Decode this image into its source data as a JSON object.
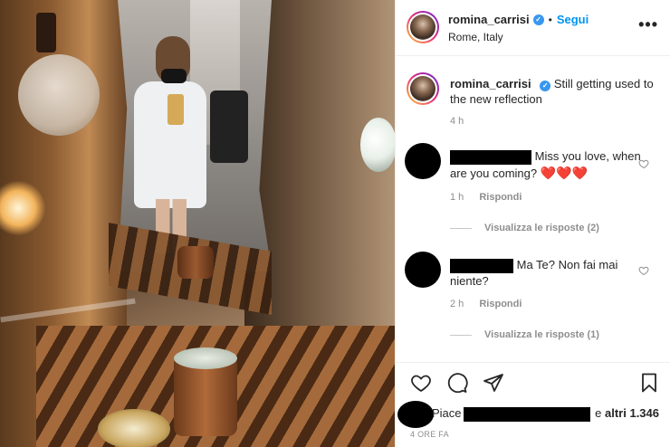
{
  "post": {
    "username": "romina_carrisi",
    "follow_label": "Segui",
    "location": "Rome, Italy",
    "more_label": "•••",
    "separator": "•"
  },
  "caption": {
    "username": "romina_carrisi",
    "text": "Still getting used to the new reflection",
    "time": "4 h"
  },
  "comments": [
    {
      "text": "Miss you love, when are you coming?",
      "emoji": "❤️❤️❤️",
      "time": "1 h",
      "reply_label": "Rispondi",
      "view_replies": "Visualizza le risposte (2)"
    },
    {
      "text": "Ma Te? Non fai mai niente?",
      "time": "2 h",
      "reply_label": "Rispondi",
      "view_replies": "Visualizza le risposte (1)"
    }
  ],
  "likes": {
    "prefix": "Piace",
    "suffix": "e",
    "others": "altri 1.346"
  },
  "post_time": "4 ORE FA",
  "colors": {
    "accent": "#0095f6",
    "heart": "#e0245e",
    "muted": "#8e8e8e"
  },
  "icons": {
    "verified": "verified-badge-icon",
    "like": "heart-icon",
    "comment": "comment-icon",
    "share": "share-icon",
    "save": "bookmark-icon"
  }
}
